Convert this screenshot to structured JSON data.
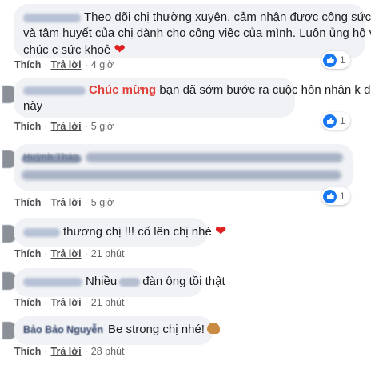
{
  "comments": [
    {
      "text": "Theo dõi chị thường xuyên, cảm nhận được công sức và tâm huyết của chị dành cho công việc của mình. Luôn ủng hộ và chúc c sức khoẻ",
      "line1": "Theo dõi chị thường xuyên, cảm nhận được công sức",
      "line2": "và tâm huyết của chị dành cho công việc của mình. Luôn ủng hộ và",
      "line3": "chúc c sức khoẻ",
      "emoji": "heart",
      "like_label": "Thích",
      "reply_label": "Trả lời",
      "time": "4 giờ",
      "reaction_count": "1"
    },
    {
      "highlight": "Chúc mừng",
      "text_after": "bạn đã sớm bước ra cuộc hôn nhân k đẹp",
      "line2": "này",
      "like_label": "Thích",
      "reply_label": "Trả lời",
      "time": "5 giờ",
      "reaction_count": "1"
    },
    {
      "visible_name": "Huỳnh Thảo",
      "like_label": "Thích",
      "reply_label": "Trả lời",
      "time": "5 giờ",
      "reaction_count": "1"
    },
    {
      "text": "thương chị !!! cố lên chị nhé",
      "emoji": "heart",
      "like_label": "Thích",
      "reply_label": "Trả lời",
      "time": "21 phút"
    },
    {
      "text_before": "Nhiều",
      "text_after": "đàn ông tồi thật",
      "like_label": "Thích",
      "reply_label": "Trả lời",
      "time": "21 phút"
    },
    {
      "visible_name": "Bảo Bảo Nguyễn",
      "text": "Be strong chị nhé!",
      "emoji": "flexed-biceps",
      "like_label": "Thích",
      "reply_label": "Trả lời",
      "time": "28 phút"
    }
  ],
  "colors": {
    "bubble": "#f0f2f5",
    "highlight": "#e0413a",
    "like_blue": "#1877f2",
    "heart": "#e02020"
  }
}
